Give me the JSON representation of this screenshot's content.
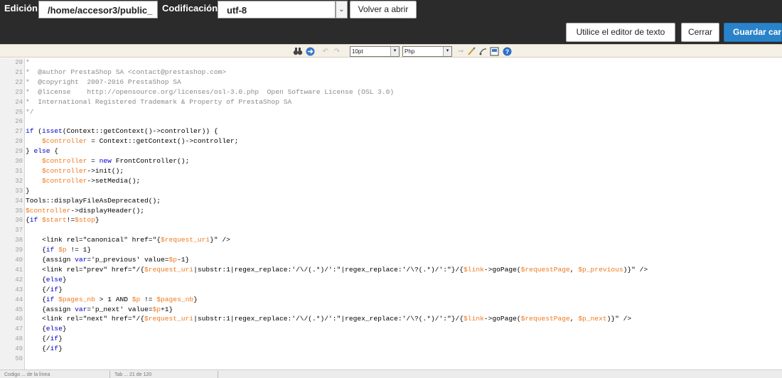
{
  "header": {
    "edit_label": "Edición:",
    "path_value": "/home/accesor3/public_",
    "encoding_label": "Codificación:",
    "encoding_value": "utf-8",
    "reopen_button": "Volver a abrir",
    "text_editor_button": "Utilice el editor de texto",
    "close_button": "Cerrar",
    "save_button": "Guardar cambios"
  },
  "toolbar": {
    "font_size": "10pt",
    "syntax": "Php",
    "icons": [
      "binoculars-icon",
      "goto-line-icon",
      "undo-icon",
      "redo-icon",
      "highlight-icon",
      "reset-icon",
      "erase-icon",
      "fullscreen-icon",
      "help-icon"
    ]
  },
  "code": {
    "lines": [
      {
        "n": "20",
        "t": "*"
      },
      {
        "n": "21",
        "t": "*  @author PrestaShop SA <contact@prestashop.com>"
      },
      {
        "n": "22",
        "t": "*  @copyright  2007-2016 PrestaShop SA"
      },
      {
        "n": "23",
        "t": "*  @license    http://opensource.org/licenses/osl-3.0.php  Open Software License (OSL 3.0)"
      },
      {
        "n": "24",
        "t": "*  International Registered Trademark & Property of PrestaShop SA"
      },
      {
        "n": "25",
        "t": "*/"
      },
      {
        "n": "26",
        "t": ""
      },
      {
        "n": "27",
        "t": "if (isset(Context::getContext()->controller)) {"
      },
      {
        "n": "28",
        "t": "    $controller = Context::getContext()->controller;"
      },
      {
        "n": "29",
        "t": "} else {"
      },
      {
        "n": "30",
        "t": "    $controller = new FrontController();"
      },
      {
        "n": "31",
        "t": "    $controller->init();"
      },
      {
        "n": "32",
        "t": "    $controller->setMedia();"
      },
      {
        "n": "33",
        "t": "}"
      },
      {
        "n": "34",
        "t": "Tools::displayFileAsDeprecated();"
      },
      {
        "n": "35",
        "t": "$controller->displayHeader();"
      },
      {
        "n": "36",
        "t": "{if $start!=$stop}"
      },
      {
        "n": "37",
        "t": ""
      },
      {
        "n": "38",
        "t": "    <link rel=\"canonical\" href=\"{$request_uri}\" />"
      },
      {
        "n": "39",
        "t": "    {if $p != 1}"
      },
      {
        "n": "40",
        "t": "    {assign var='p_previous' value=$p-1}"
      },
      {
        "n": "41",
        "t": "    <link rel=\"prev\" href=\"/{$request_uri|substr:1|regex_replace:'/\\/(.*)/':\"|regex_replace:'/\\?(.*)/':\"}/{$link->goPage($requestPage, $p_previous)}\" />"
      },
      {
        "n": "42",
        "t": "    {else}"
      },
      {
        "n": "43",
        "t": "    {/if}"
      },
      {
        "n": "44",
        "t": "    {if $pages_nb > 1 AND $p != $pages_nb}"
      },
      {
        "n": "45",
        "t": "    {assign var='p_next' value=$p+1}"
      },
      {
        "n": "46",
        "t": "    <link rel=\"next\" href=\"/{$request_uri|substr:1|regex_replace:'/\\/(.*)/':\"|regex_replace:'/\\?(.*)/':\"}/{$link->goPage($requestPage, $p_next)}\" />"
      },
      {
        "n": "47",
        "t": "    {else}"
      },
      {
        "n": "48",
        "t": "    {/if}"
      },
      {
        "n": "49",
        "t": "    {/if}"
      },
      {
        "n": "50",
        "t": ""
      }
    ]
  },
  "status_bar": {
    "tab1": "Codigo ... de la línea",
    "tab2": "Tab ... 21 de 120"
  },
  "colors": {
    "topbar": "#2b2b2b",
    "accent": "#2a83c9",
    "keyword": "#0000c8",
    "variable": "#f07a20",
    "comment": "#8a8a8a"
  }
}
